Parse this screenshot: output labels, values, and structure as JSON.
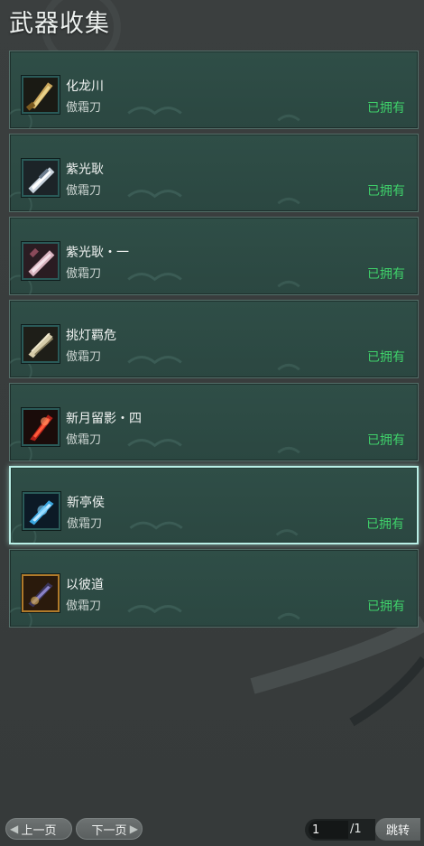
{
  "page": {
    "title": "武器收集"
  },
  "weapons": [
    {
      "name": "化龙川",
      "type": "傲霜刀",
      "status": "已拥有",
      "icon": "golden-blade-icon"
    },
    {
      "name": "紫光耿",
      "type": "傲霜刀",
      "status": "已拥有",
      "icon": "silver-blade-icon"
    },
    {
      "name": "紫光耿・一",
      "type": "傲霜刀",
      "status": "已拥有",
      "icon": "pink-silver-blade-icon"
    },
    {
      "name": "挑灯羁危",
      "type": "傲霜刀",
      "status": "已拥有",
      "icon": "bone-blade-icon"
    },
    {
      "name": "新月留影・四",
      "type": "傲霜刀",
      "status": "已拥有",
      "icon": "red-flame-blade-icon"
    },
    {
      "name": "新亭侯",
      "type": "傲霜刀",
      "status": "已拥有",
      "icon": "blue-ice-blade-icon"
    },
    {
      "name": "以彼道",
      "type": "傲霜刀",
      "status": "已拥有",
      "icon": "purple-dark-blade-icon"
    }
  ],
  "selected_index": 5,
  "pagination": {
    "prev_label": "上一页",
    "next_label": "下一页",
    "current_page": "1",
    "total": "/1",
    "jump_label": "跳转"
  },
  "colors": {
    "owned_text": "#3fd06a",
    "card_bg": "#2f4e47",
    "selected_border": "#b9efe6"
  }
}
